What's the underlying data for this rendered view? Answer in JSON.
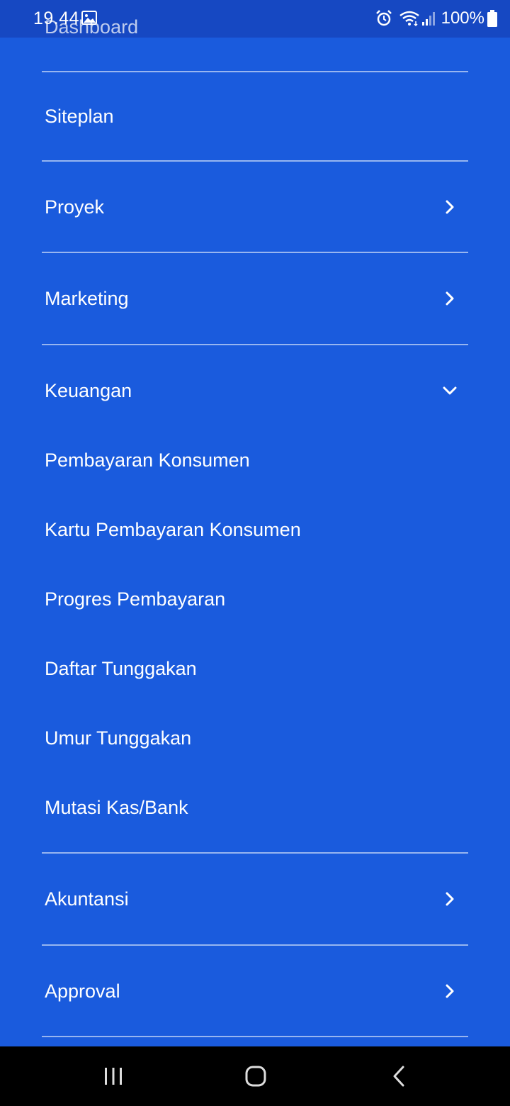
{
  "status_bar": {
    "time": "19.44",
    "battery": "100%",
    "icons": [
      "gallery-icon",
      "alarm-icon",
      "wifi-icon",
      "signal-icon",
      "battery-icon"
    ]
  },
  "header": {
    "title": "Dashboard"
  },
  "menu": {
    "siteplan": {
      "label": "Siteplan"
    },
    "proyek": {
      "label": "Proyek",
      "icon": "chevron-right-icon"
    },
    "marketing": {
      "label": "Marketing",
      "icon": "chevron-right-icon"
    },
    "keuangan": {
      "label": "Keuangan",
      "icon": "chevron-down-icon",
      "expanded": true,
      "items": [
        {
          "label": "Pembayaran Konsumen"
        },
        {
          "label": "Kartu Pembayaran Konsumen"
        },
        {
          "label": "Progres Pembayaran"
        },
        {
          "label": "Daftar Tunggakan"
        },
        {
          "label": "Umur Tunggakan"
        },
        {
          "label": "Mutasi Kas/Bank"
        }
      ]
    },
    "akuntansi": {
      "label": "Akuntansi",
      "icon": "chevron-right-icon"
    },
    "approval": {
      "label": "Approval",
      "icon": "chevron-right-icon"
    }
  },
  "nav_bar": {
    "buttons": [
      "recent-apps-icon",
      "home-icon",
      "back-icon"
    ]
  },
  "colors": {
    "background": "#1a5bdd",
    "status_bar": "#1648c2",
    "text": "#ffffff",
    "nav_bar": "#000000"
  }
}
